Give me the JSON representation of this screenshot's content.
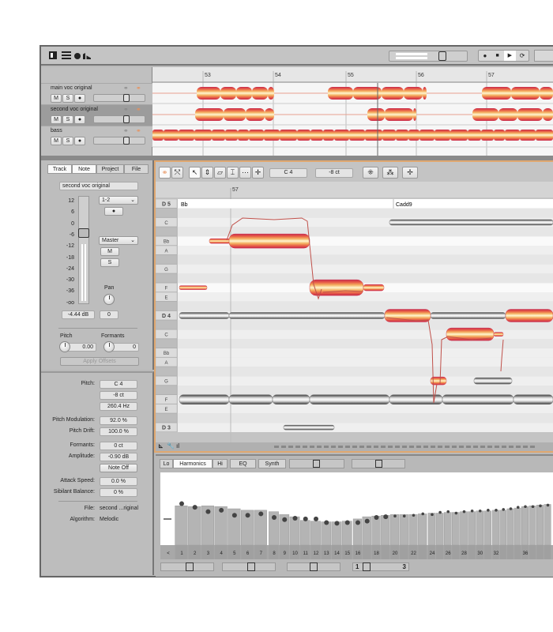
{
  "toolbar": {
    "transport": {
      "record": "●",
      "stop": "■",
      "play": "▶",
      "loop": "⟳"
    }
  },
  "ruler": {
    "bars": [
      "53",
      "54",
      "55",
      "56",
      "57"
    ]
  },
  "tracks": [
    {
      "name": "main voc original",
      "mute": "M",
      "solo": "S",
      "rec": "●",
      "selected": false,
      "volume": 0.62
    },
    {
      "name": "second voc original",
      "mute": "M",
      "solo": "S",
      "rec": "●",
      "selected": true,
      "volume": 0.62
    },
    {
      "name": "bass",
      "mute": "M",
      "solo": "S",
      "rec": "●",
      "selected": false,
      "volume": 0.62
    }
  ],
  "inspector": {
    "tabs": [
      "Track",
      "Note",
      "Project",
      "File"
    ],
    "active_tab": "Note",
    "track_name": "second voc original",
    "meter_scale": [
      "12",
      "6",
      "0",
      "-6",
      "-12",
      "-18",
      "-24",
      "-30",
      "-36",
      "-oo"
    ],
    "input": "1-2",
    "output": "Master",
    "mute": "M",
    "solo": "S",
    "rec": "●",
    "pan_label": "Pan",
    "volume": "-4.44 dB",
    "pan": "0",
    "pitch_label": "Pitch",
    "pitch": "0.00",
    "formants_label": "Formants",
    "formants": "0",
    "apply": "Apply Offsets"
  },
  "note_props": {
    "pitch_label": "Pitch:",
    "pitch": "C 4",
    "cents": "-8 ct",
    "hz": "260.4 Hz",
    "mod_label": "Pitch Modulation:",
    "mod": "92.0 %",
    "drift_label": "Pitch Drift:",
    "drift": "100.0 %",
    "formants_label": "Formants:",
    "formants": "0 ct",
    "amp_label": "Amplitude:",
    "amp": "-0.90 dB",
    "note_off": "Note Off",
    "attack_label": "Attack Speed:",
    "attack": "0.0 %",
    "sibilant_label": "Sibilant Balance:",
    "sibilant": "0 %",
    "file_label": "File:",
    "file": "second ...riginal",
    "algo_label": "Algorithm:",
    "algo": "Melodic"
  },
  "editor": {
    "pitch_field": "C 4",
    "cents_field": "-8 ct",
    "bar": "57",
    "chords": [
      "Bb",
      "Cadd9"
    ],
    "keys": [
      "D 5",
      "",
      "C",
      "",
      "Bb",
      "A",
      "",
      "G",
      "",
      "F",
      "E",
      "",
      "D 4",
      "",
      "C",
      "",
      "Bb",
      "A",
      "",
      "G",
      "",
      "F",
      "E",
      "",
      "D 3"
    ]
  },
  "harmonics": {
    "tabs": [
      "Lo",
      "Harmonics",
      "Hi",
      "EQ",
      "Synth"
    ],
    "active_tab": "Harmonics",
    "labels": [
      "<",
      "1",
      "2",
      "3",
      "4",
      "5",
      "6",
      "7",
      "8",
      "9",
      "10",
      "11",
      "12",
      "13",
      "14",
      "15",
      "16",
      "18",
      "20",
      "22",
      "24",
      "26",
      "28",
      "30",
      "32",
      "36"
    ],
    "range_start": "1",
    "range_end": "3",
    "levels": [
      0.54,
      0.53,
      0.54,
      0.53,
      0.5,
      0.48,
      0.48,
      0.46,
      0.42,
      0.39,
      0.34,
      0.33,
      0.32,
      0.32,
      0.33,
      0.36,
      0.39,
      0.4,
      0.41,
      0.42,
      0.42,
      0.42,
      0.43,
      0.44,
      0.44,
      0.45,
      0.45,
      0.46,
      0.46,
      0.47,
      0.47,
      0.48,
      0.48,
      0.5,
      0.51,
      0.53,
      0.54,
      0.55,
      0.56,
      0.57
    ],
    "dots": [
      0.57,
      0.52,
      0.46,
      0.48,
      0.41,
      0.41,
      0.43,
      0.38,
      0.35,
      0.37,
      0.36,
      0.36,
      0.31,
      0.3,
      0.31,
      0.31,
      0.33,
      0.38,
      0.39,
      0.4,
      0.4,
      0.41,
      0.43,
      0.42,
      0.45,
      0.46,
      0.44,
      0.46,
      0.47,
      0.47,
      0.48,
      0.48,
      0.49,
      0.5,
      0.52,
      0.53,
      0.53,
      0.54,
      0.55,
      0.56
    ]
  },
  "colors": {
    "accent": "#e8a060",
    "note_red": "#d03050",
    "note_yellow": "#f8e090"
  }
}
